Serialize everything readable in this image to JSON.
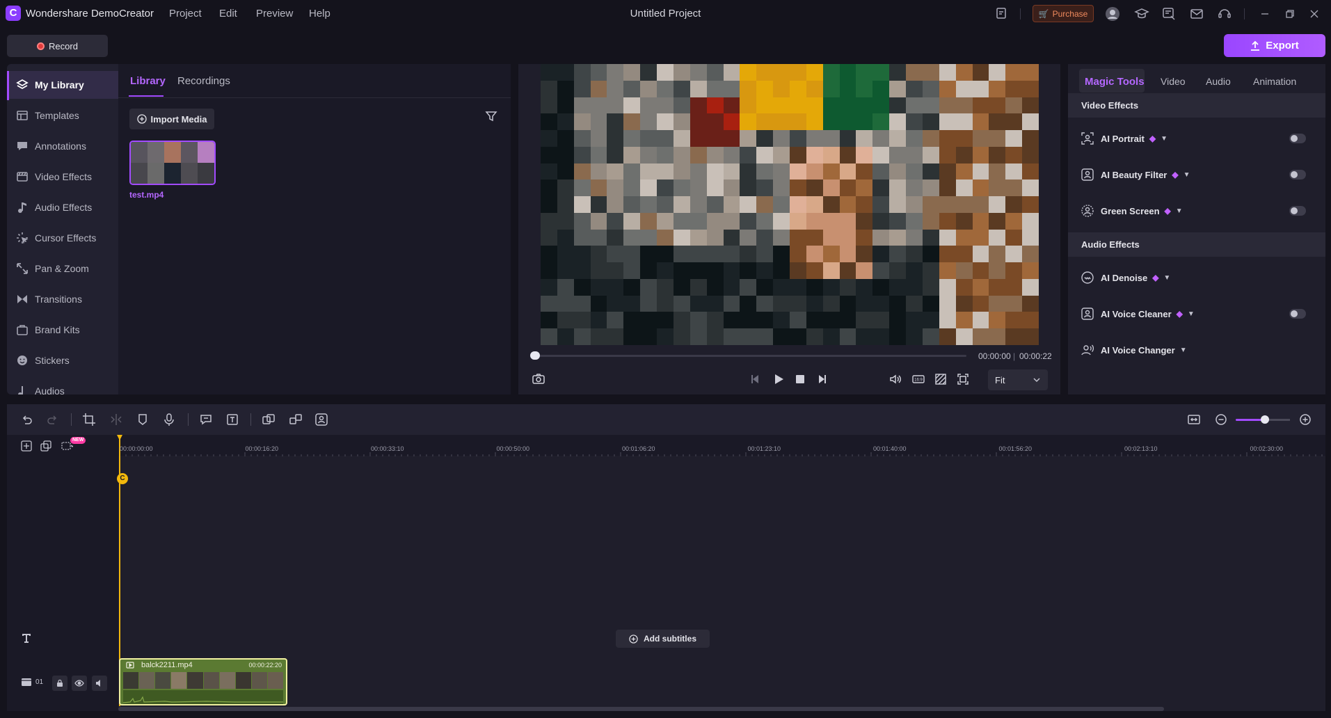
{
  "app": {
    "name": "Wondershare DemoCreator",
    "project_title": "Untitled Project",
    "menus": [
      "Project",
      "Edit",
      "Preview",
      "Help"
    ],
    "purchase_label": "Purchase",
    "record_label": "Record",
    "export_label": "Export",
    "accent_color": "#a24bff"
  },
  "left_nav": {
    "items": [
      {
        "label": "My Library",
        "icon": "layers-icon",
        "active": true
      },
      {
        "label": "Templates",
        "icon": "templates-icon"
      },
      {
        "label": "Annotations",
        "icon": "annotation-icon"
      },
      {
        "label": "Video Effects",
        "icon": "video-effects-icon"
      },
      {
        "label": "Audio Effects",
        "icon": "music-note-icon"
      },
      {
        "label": "Cursor Effects",
        "icon": "cursor-icon"
      },
      {
        "label": "Pan & Zoom",
        "icon": "pan-zoom-icon"
      },
      {
        "label": "Transitions",
        "icon": "transitions-icon"
      },
      {
        "label": "Brand Kits",
        "icon": "brand-kit-icon"
      },
      {
        "label": "Stickers",
        "icon": "sticker-icon"
      },
      {
        "label": "Audios",
        "icon": "audio-icon"
      }
    ]
  },
  "library": {
    "tabs": [
      "Library",
      "Recordings"
    ],
    "import_label": "Import Media",
    "media": [
      {
        "name": "test.mp4"
      }
    ]
  },
  "preview": {
    "time_current": "00:00:00",
    "time_separator": "|",
    "time_total": "00:00:22",
    "progress": 0,
    "fit_label": "Fit"
  },
  "right_panel": {
    "tabs": [
      "Magic Tools",
      "Video",
      "Audio",
      "Animation"
    ],
    "video_effects_title": "Video Effects",
    "video_tools": [
      {
        "label": "AI Portrait",
        "premium": true,
        "toggle": false
      },
      {
        "label": "AI Beauty Filter",
        "premium": true,
        "toggle": false
      },
      {
        "label": "Green Screen",
        "premium": true,
        "toggle": false
      }
    ],
    "audio_effects_title": "Audio Effects",
    "audio_tools": [
      {
        "label": "AI Denoise",
        "premium": true
      },
      {
        "label": "AI Voice Cleaner",
        "premium": true,
        "toggle": false
      },
      {
        "label": "AI Voice Changer",
        "premium": false
      }
    ]
  },
  "timeline": {
    "ruler_labels": [
      "00:00:00:00",
      "00:00:16:20",
      "00:00:33:10",
      "00:00:50:00",
      "00:01:06:20",
      "00:01:23:10",
      "00:01:40:00",
      "00:01:56:20",
      "00:02:13:10",
      "00:02:30:00"
    ],
    "new_badge": "NEW",
    "marker_label": "C",
    "add_subtitles_label": "Add subtitles",
    "track_number": "01",
    "clip": {
      "name": "balck2211.mp4",
      "duration": "00:00:22:20"
    },
    "zoom_level": 0.5
  }
}
